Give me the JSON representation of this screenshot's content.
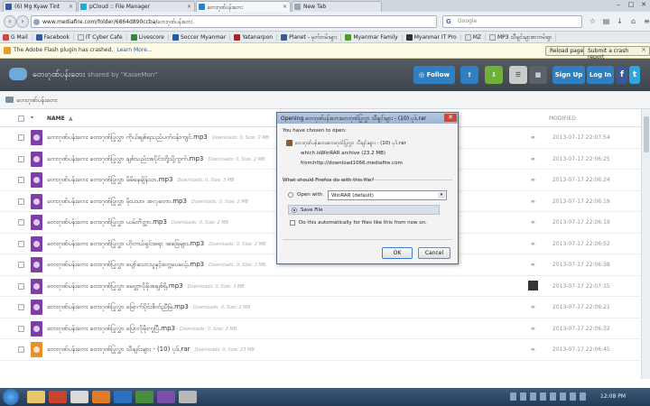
{
  "browser": {
    "tabs": [
      {
        "label": "(6) Mg Kyaw Tint",
        "active": false
      },
      {
        "label": "pCloud :: File Manager",
        "active": false
      },
      {
        "label": "တေးဂုဏ်ပန်းတေး",
        "active": true
      },
      {
        "label": "New Tab",
        "active": false
      }
    ],
    "window_controls": [
      "–",
      "□",
      "✕"
    ],
    "url": "www.mediafire.com/folder/6864d890ccba/တေးဂုဏ်ပန်းတေး",
    "search_engine": "G",
    "search_placeholder": "Google"
  },
  "bookmarks": [
    "G Mail",
    "Facebook",
    "IT Cyber Cafe",
    "Livescore",
    "Soccer Myanmar",
    "Yatanarpon",
    "Planet - မှတ်တမ်းများ",
    "Myanmar Family",
    "Myanmar IT Pro",
    "MZ",
    "MP3 သီချင်းများစာတမ်းရှာ"
  ],
  "notification": {
    "message": "The Adobe Flash plugin has crashed.",
    "learn_more": "Learn More...",
    "reload_label": "Reload page",
    "submit_label": "Submit a crash report",
    "close": "×"
  },
  "header": {
    "title": "တေးဂုဏ်ပန်းတေး",
    "shared_by": "shared by \"KaiaeMon\"",
    "follow_label": "Follow",
    "signup_label": "Sign Up",
    "login_label": "Log In",
    "facebook_label": "f",
    "twitter_label": "t",
    "colors": {
      "follow": "#2f7fc1",
      "download": "#6fb03b",
      "signup": "#2f7fc1"
    }
  },
  "breadcrumb": "တေးဂုဏ်ပန်းတေး",
  "columns": {
    "name": "NAME",
    "modified": "MODIFIED"
  },
  "files": [
    {
      "name": "တေးဂုဏ်ပန်းတေး တေးဂုဏ်ပြုလွှာ ကိုယ်ချစ်ရသည်ပတ်ဝန်းကျင်.mp3",
      "meta": "Downloads: 0, Size: 2 MB",
      "date": "2013-07-17 22:07:54",
      "icon": "purple",
      "marker": "link"
    },
    {
      "name": "တေးဂုဏ်ပန်းတေး တေးဂုဏ်ပြုလွှာ ချစ်သည်းအပိုင်းတို့သို့ကွက်.mp3",
      "meta": "Downloads: 0, Size: 2 MB",
      "date": "2013-07-17 22:06:25",
      "icon": "purple",
      "marker": "link"
    },
    {
      "name": "တေးဂုဏ်ပန်းတေး တေးဂုဏ်ပြုလွှာ မိမိနေချိန်သာ.mp3",
      "meta": "Downloads: 0, Size: 3 MB",
      "date": "2013-07-17 22:06:24",
      "icon": "purple",
      "marker": "link"
    },
    {
      "name": "တေးဂုဏ်ပန်းတေး တေးဂုဏ်ပြုလွှာ မိုးပသာ၊ အလှတော.mp3",
      "meta": "Downloads: 0, Size: 2 MB",
      "date": "2013-07-17 22:06:19",
      "icon": "purple",
      "marker": "link"
    },
    {
      "name": "တေးဂုဏ်ပန်းတေး တေးဂုဏ်ပြုလွှာ ယမ်ဘိတ္တာ.mp3",
      "meta": "Downloads: 0, Size: 2 MB",
      "date": "2013-07-17 22:06:19",
      "icon": "purple",
      "marker": "link"
    },
    {
      "name": "တေးဂုဏ်ပန်းတေး တေးဂုဏ်ပြုလွှာ ဟိုတယ်ရှင်းစရာ အဖြေများ.mp3",
      "meta": "Downloads: 0, Size: 2 MB",
      "date": "2013-07-17 22:06:52",
      "icon": "purple",
      "marker": "link"
    },
    {
      "name": "တေးဂုဏ်ပန်းတေး တေးဂုဏ်ပြုလွှာ ပျော်သောသူနှင့်တွေ့ပေမယ့်.mp3",
      "meta": "Downloads: 0, Size: 3 MB",
      "date": "2013-07-17 22:06:38",
      "icon": "purple",
      "marker": "link"
    },
    {
      "name": "တေးဂုဏ်ပန်းတေး တေးဂုဏ်ပြုလွှာ မေတ္တာပိုမိုအချစ်ရှိ.mp3",
      "meta": "Downloads: 0, Size: 3 MB",
      "date": "2013-07-17 22:07:15",
      "icon": "purple",
      "marker": "dark"
    },
    {
      "name": "တေးဂုဏ်ပန်းတေး တေးဂုဏ်ပြုလွှာ မြောက်ပိုင်းစိတ်ညီမြဲ.mp3",
      "meta": "Downloads: 0, Size: 2 MB",
      "date": "2013-07-17 22:06:21",
      "icon": "purple",
      "marker": "link"
    },
    {
      "name": "တေးဂုဏ်ပန်းတေး တေးဂုဏ်ပြုလွှာ ပြောလိုမိုးကူပြီ.mp3",
      "meta": "Downloads: 0, Size: 3 MB",
      "date": "2013-07-17 22:06:32",
      "icon": "purple",
      "marker": "link"
    },
    {
      "name": "တေးဂုဏ်ပန်းတေး တေးဂုဏ်ပြုလွှာ သီချင်းများ - (10) ပုဒ်.rar",
      "meta": "Downloads: 0, Size: 23 MB",
      "date": "2013-07-17 22:06:45",
      "icon": "orange",
      "marker": "link"
    }
  ],
  "dialog": {
    "title": "Opening တေးဂုဏ်ပန်းတေးတေးဂုဏ်ပြုလွှာ သီချင်းများ - (10) ပုဒ်.rar",
    "close": "✕",
    "intro": "You have chosen to open:",
    "filename": "တေးဂုဏ်ပန်းတေးတေးဂုဏ်ပြုလွှာ သီချင်းများ - (10) ပုဒ်.rar",
    "which_is_label": "which is:",
    "which_is_value": "WinRAR archive (23.2 MB)",
    "from_label": "from:",
    "from_value": "http://download1066.mediafire.com",
    "question": "What should Firefox do with this file?",
    "open_with_label": "Open with",
    "open_with_app": "WinRAR (default)",
    "save_label": "Save File",
    "auto_label": "Do this automatically for files like this from now on.",
    "ok_label": "OK",
    "cancel_label": "Cancel"
  },
  "taskbar": {
    "clock": "12:08 PM"
  }
}
